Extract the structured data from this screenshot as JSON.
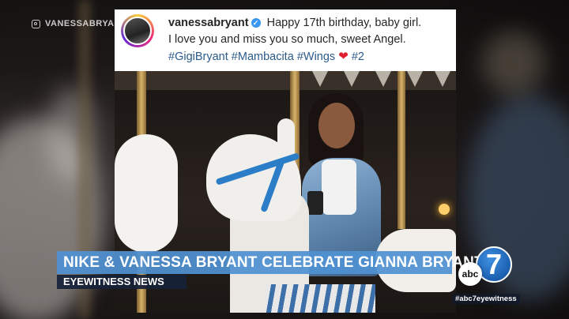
{
  "watermark": {
    "handle": "VANESSABRYA",
    "icon": "instagram-icon"
  },
  "post": {
    "username": "vanessabryant",
    "verified_icon": "verified-badge-icon",
    "caption_line1": "Happy 17th birthday, baby girl.",
    "caption_line2": "I love you and miss you so much, sweet Angel.",
    "hashtags": [
      "#GigiBryant",
      "#Mambacita",
      "#Wings",
      "#2"
    ],
    "heart_icon": "red-heart-icon",
    "heart_glyph": "❤"
  },
  "lower_third": {
    "headline": "NIKE & VANESSA BRYANT CELEBRATE GIANNA BRYANT",
    "program": "EYEWITNESS NEWS",
    "headline_color": "#5091d2",
    "program_color": "#16223a"
  },
  "station": {
    "abc": "abc",
    "channel": "7",
    "hashtag": "#abc7eyewitness"
  }
}
